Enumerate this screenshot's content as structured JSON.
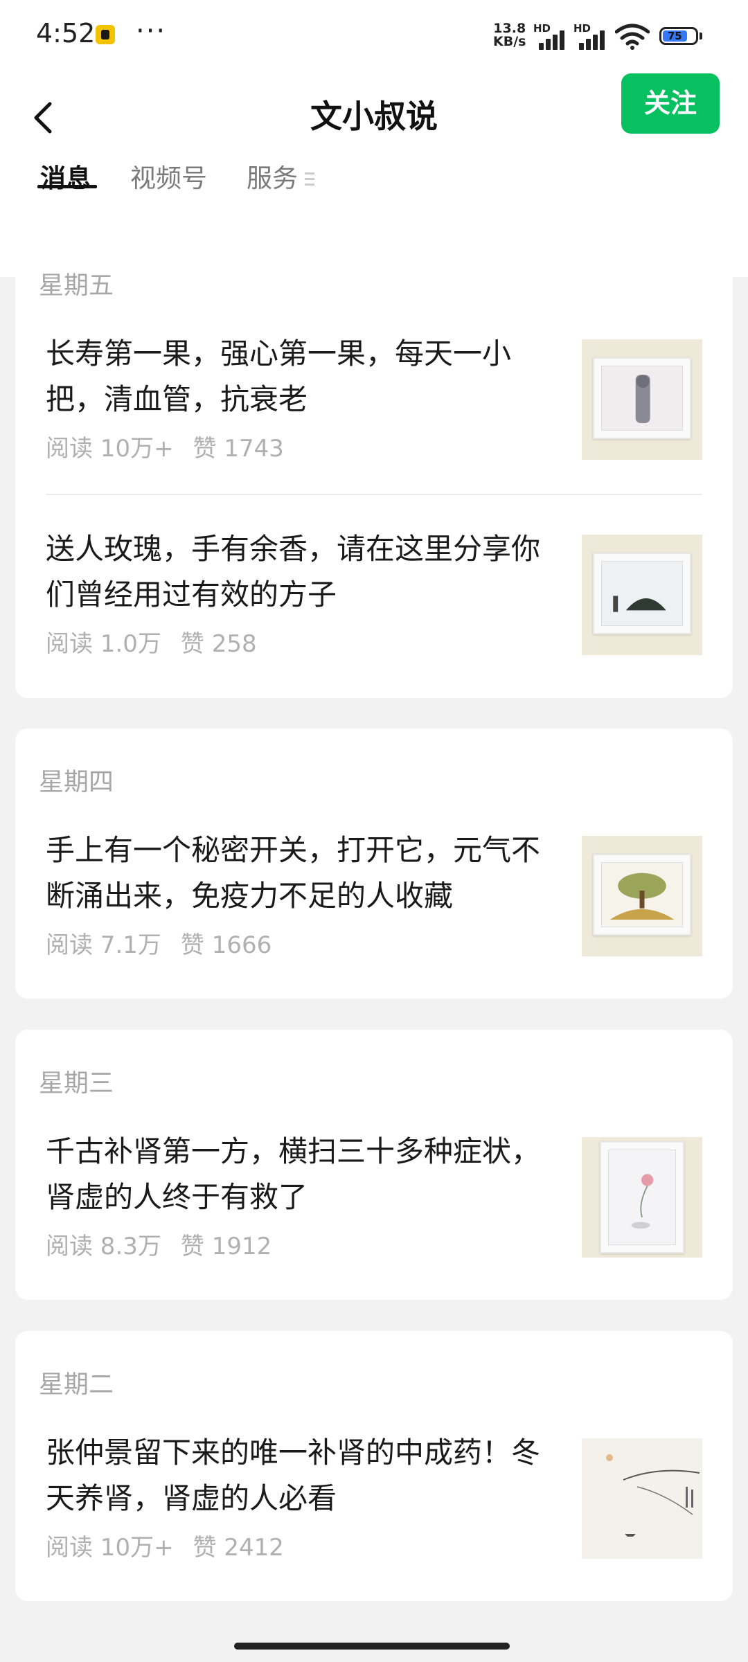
{
  "status_bar": {
    "time": "4:52",
    "dots": "···",
    "net_speed_value": "13.8",
    "net_speed_unit": "KB/s",
    "hd_label": "HD",
    "battery": "75"
  },
  "header": {
    "title": "文小叔说",
    "follow_label": "关注"
  },
  "tabs": [
    {
      "label": "消息",
      "active": true
    },
    {
      "label": "视频号",
      "active": false
    },
    {
      "label": "服务",
      "active": false
    }
  ],
  "groups": [
    {
      "day": "星期五",
      "articles": [
        {
          "title": "长寿第一果，强心第一果，每天一小把，清血管，抗衰老",
          "reads": "阅读 10万+",
          "likes": "赞 1743"
        },
        {
          "title": "送人玫瑰，手有余香，请在这里分享你们曾经用过有效的方子",
          "reads": "阅读 1.0万",
          "likes": "赞 258"
        }
      ]
    },
    {
      "day": "星期四",
      "articles": [
        {
          "title": "手上有一个秘密开关，打开它，元气不断涌出来，免疫力不足的人收藏",
          "reads": "阅读 7.1万",
          "likes": "赞 1666"
        }
      ]
    },
    {
      "day": "星期三",
      "articles": [
        {
          "title": "千古补肾第一方，横扫三十多种症状，肾虚的人终于有救了",
          "reads": "阅读 8.3万",
          "likes": "赞 1912"
        }
      ]
    },
    {
      "day": "星期二",
      "articles": [
        {
          "title": "张仲景留下来的唯一补肾的中成药！冬天养肾，肾虚的人必看",
          "reads": "阅读 10万+",
          "likes": "赞 2412"
        }
      ]
    }
  ],
  "colors": {
    "accent": "#07c160",
    "background": "#f2f2f2",
    "meta_text": "#b0b0b0"
  }
}
